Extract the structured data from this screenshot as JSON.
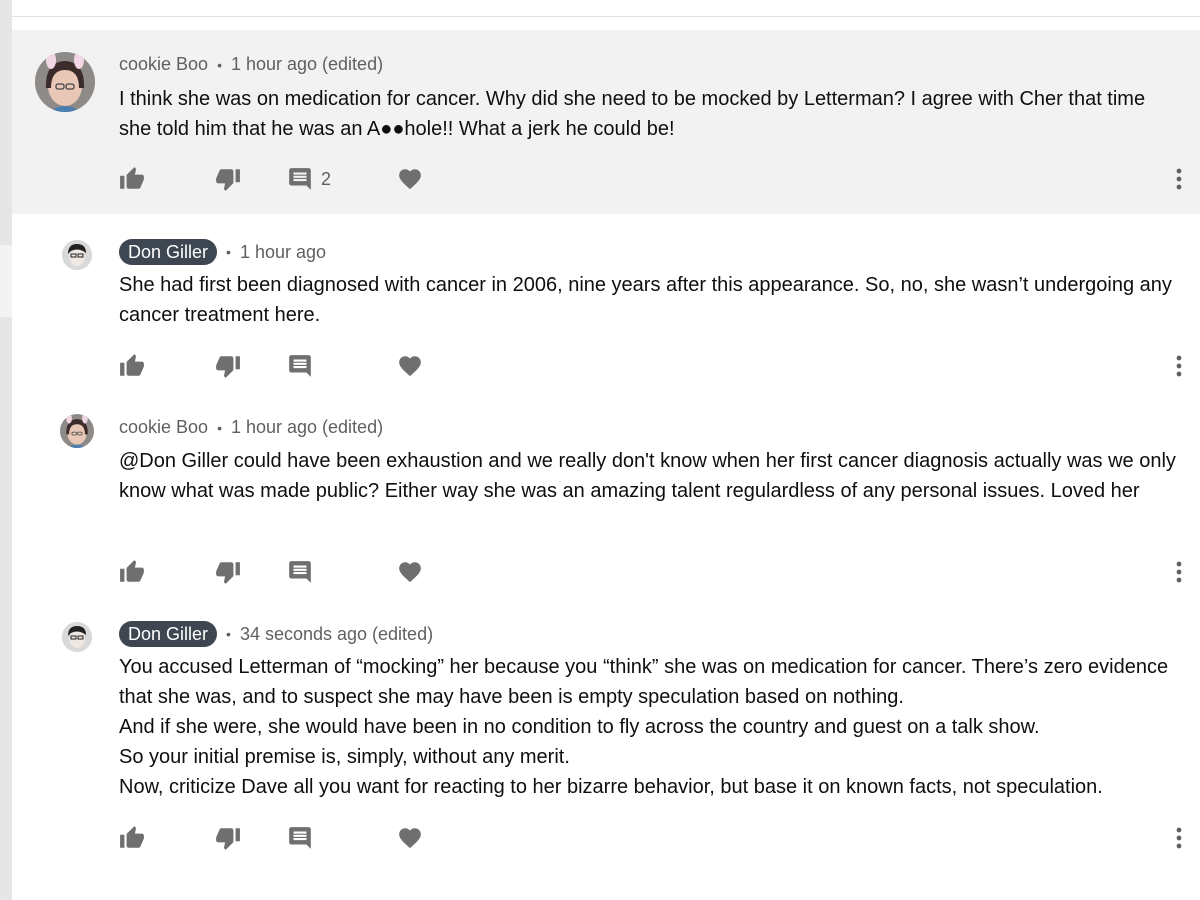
{
  "comments": [
    {
      "author": "cookie Boo",
      "author_style": "plain",
      "time": "1 hour ago (edited)",
      "text": "I think she was on medication for cancer. Why did she need to be mocked by Letterman? I agree with Cher that time she told him that he was an A●●hole!! What a jerk he could be!",
      "reply_count": "2",
      "highlighted": true
    },
    {
      "author": "Don Giller",
      "author_style": "badge",
      "time": "1 hour ago",
      "text": "She had first been diagnosed with cancer in 2006, nine years after this appearance. So, no, she wasn’t undergoing any cancer treatment here.",
      "reply_count": "",
      "highlighted": false
    },
    {
      "author": "cookie Boo",
      "author_style": "plain",
      "time": "1 hour ago (edited)",
      "text": "@Don Giller could have been exhaustion and we really don't know when her first cancer diagnosis actually was we only know what was made public? Either way she was an amazing talent regulardless of any personal issues. Loved her",
      "reply_count": "",
      "highlighted": false
    },
    {
      "author": "Don Giller",
      "author_style": "badge",
      "time": "34 seconds ago (edited)",
      "text": "You accused Letterman of “mocking” her because you “think” she was on medication for cancer. There’s zero evidence that she was, and to suspect she may have been is empty speculation based on nothing.\nAnd if she were, she would have been in no condition to fly across the country and guest on a talk show.\nSo your initial premise is, simply, without any merit.\nNow, criticize Dave all you want for reacting to her bizarre behavior, but base it on known facts, not speculation.",
      "reply_count": "",
      "highlighted": false
    }
  ],
  "icons": {
    "like": "thumb-up-icon",
    "dislike": "thumb-down-icon",
    "reply": "comment-icon",
    "heart": "heart-icon",
    "more": "more-vertical-icon"
  },
  "colors": {
    "highlight_bg": "#f2f2f2",
    "badge_bg": "#3d4651",
    "icon": "#6f6f6f"
  }
}
